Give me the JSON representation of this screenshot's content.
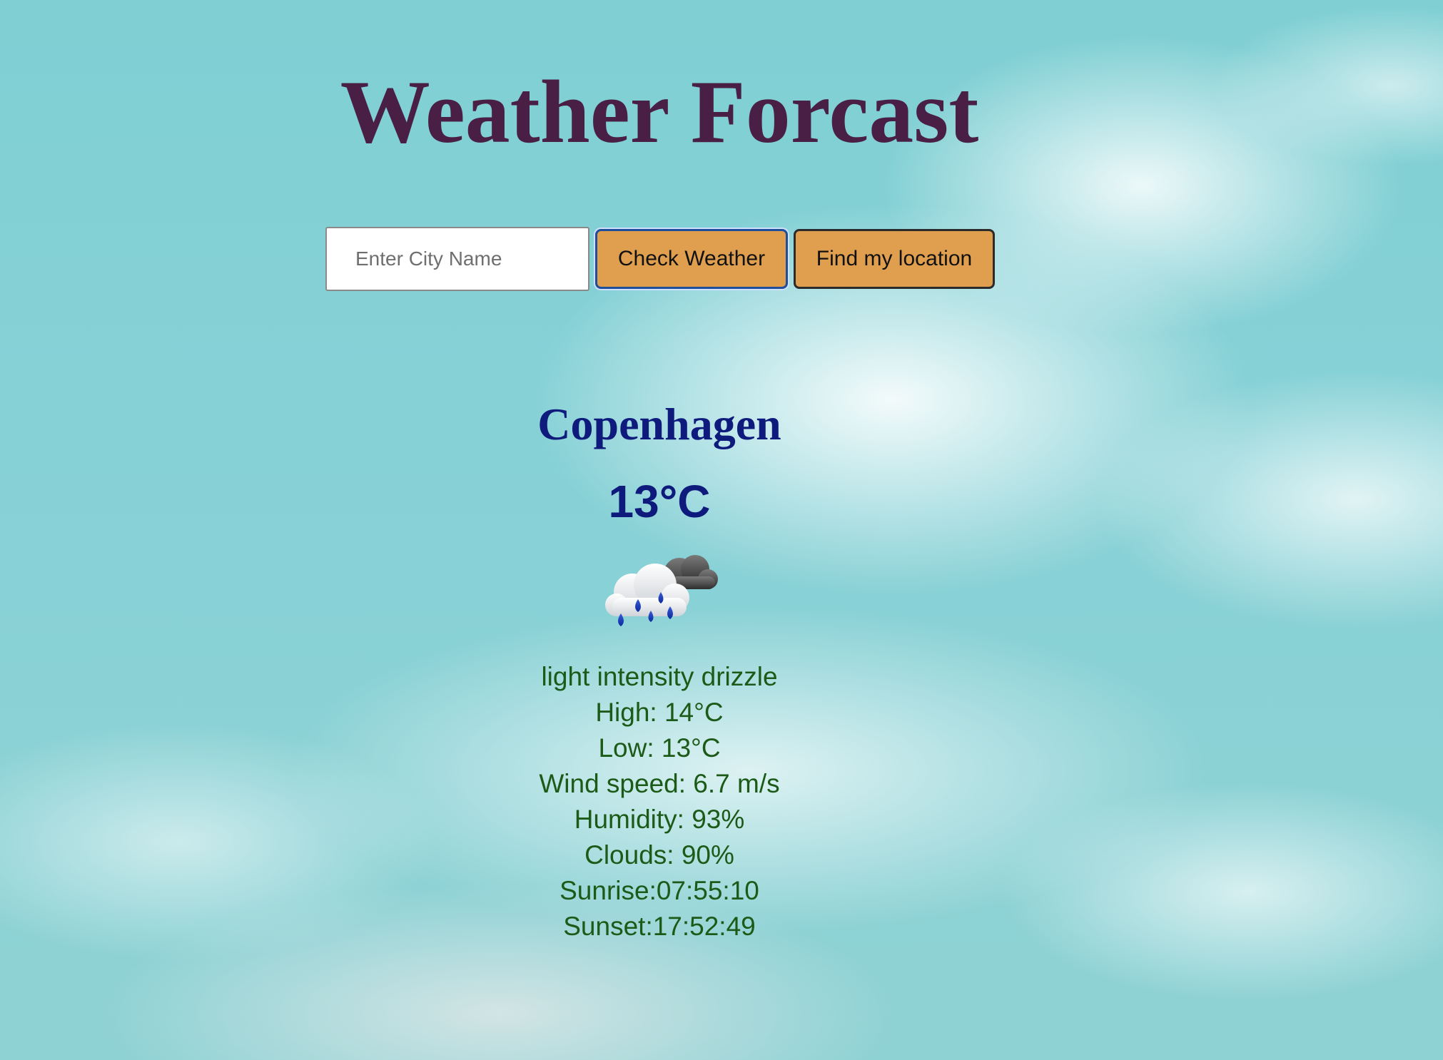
{
  "header": {
    "title": "Weather Forcast"
  },
  "search": {
    "placeholder": "Enter City Name",
    "value": "",
    "check_label": "Check Weather",
    "locate_label": "Find my location"
  },
  "weather": {
    "city": "Copenhagen",
    "temperature": "13°C",
    "icon": "rain-cloud-icon",
    "description": "light intensity drizzle",
    "high": "High: 14°C",
    "low": "Low: 13°C",
    "wind": "Wind speed: 6.7 m/s",
    "humidity": "Humidity: 93%",
    "clouds": "Clouds: 90%",
    "sunrise": "Sunrise:07:55:10",
    "sunset": "Sunset:17:52:49"
  },
  "colors": {
    "title": "#4a1f45",
    "city_temp": "#0e1a7c",
    "details": "#1c5a17",
    "button": "#e09f4e",
    "sky": "#86d1d6"
  }
}
